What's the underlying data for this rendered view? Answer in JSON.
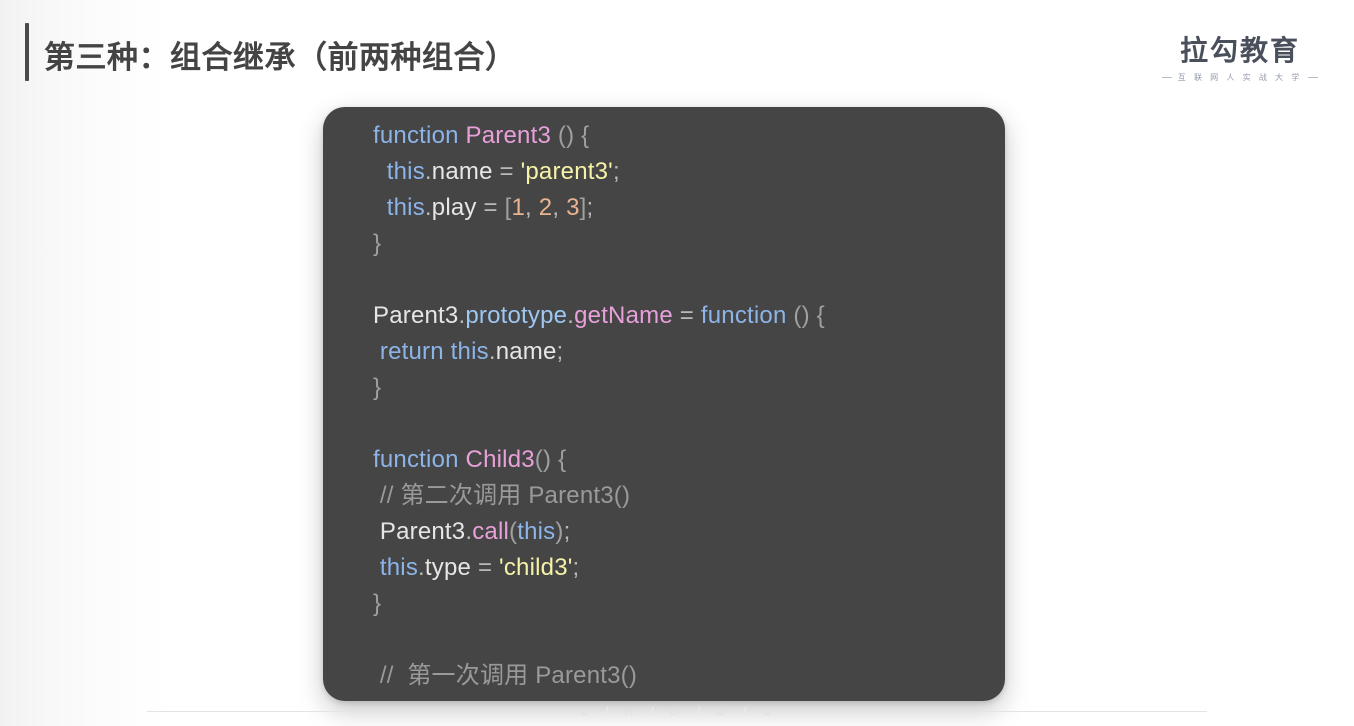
{
  "header": {
    "title": "第三种：组合继承（前两种组合）",
    "brand_name": "拉勾教育",
    "brand_sub": "互 联 网 人 实 战 大 学"
  },
  "colors": {
    "page_background": "#ffffff",
    "code_background": "#454545",
    "title_text": "#444444",
    "accent_bar": "#4a4a4a",
    "keyword": "#8cb4e8",
    "function_name": "#e8a0da",
    "property": "#9dc6f2",
    "string": "#f6f2a8",
    "number": "#eab48f",
    "comment": "#9a9a9a",
    "plain": "#e6e6e6"
  },
  "code": {
    "language": "javascript",
    "lines": [
      "function Parent3 () {",
      "  this.name = 'parent3';",
      "  this.play = [1, 2, 3];",
      "}",
      "",
      "Parent3.prototype.getName = function () {",
      "  return this.name;",
      "}",
      "",
      "function Child3() {",
      "  // 第二次调用 Parent3()",
      "  Parent3.call(this);",
      "  this.type = 'child3';",
      "}",
      "",
      "  // 第一次调用 Parent3()"
    ],
    "tokens": [
      [
        {
          "t": "function",
          "c": "t-kw"
        },
        {
          "t": " ",
          "c": "t-pun"
        },
        {
          "t": "Parent3",
          "c": "t-fn"
        },
        {
          "t": " ",
          "c": "t-pun"
        },
        {
          "t": "()",
          "c": "t-dim"
        },
        {
          "t": " ",
          "c": "t-pun"
        },
        {
          "t": "{",
          "c": "t-dim"
        }
      ],
      [
        {
          "t": "  ",
          "c": "t-pun"
        },
        {
          "t": "this",
          "c": "t-kw"
        },
        {
          "t": ".",
          "c": "t-pun"
        },
        {
          "t": "name",
          "c": "t-id"
        },
        {
          "t": " ",
          "c": "t-pun"
        },
        {
          "t": "=",
          "c": "t-pun"
        },
        {
          "t": " ",
          "c": "t-pun"
        },
        {
          "t": "'parent3'",
          "c": "t-str"
        },
        {
          "t": ";",
          "c": "t-pun"
        }
      ],
      [
        {
          "t": "  ",
          "c": "t-pun"
        },
        {
          "t": "this",
          "c": "t-kw"
        },
        {
          "t": ".",
          "c": "t-pun"
        },
        {
          "t": "play",
          "c": "t-id"
        },
        {
          "t": " ",
          "c": "t-pun"
        },
        {
          "t": "=",
          "c": "t-pun"
        },
        {
          "t": " ",
          "c": "t-pun"
        },
        {
          "t": "[",
          "c": "t-dim"
        },
        {
          "t": "1",
          "c": "t-num"
        },
        {
          "t": ", ",
          "c": "t-pun"
        },
        {
          "t": "2",
          "c": "t-num"
        },
        {
          "t": ", ",
          "c": "t-pun"
        },
        {
          "t": "3",
          "c": "t-num"
        },
        {
          "t": "]",
          "c": "t-dim"
        },
        {
          "t": ";",
          "c": "t-pun"
        }
      ],
      [
        {
          "t": "}",
          "c": "t-dim"
        }
      ],
      [],
      [
        {
          "t": "Parent3",
          "c": "t-id"
        },
        {
          "t": ".",
          "c": "t-pun"
        },
        {
          "t": "prototype",
          "c": "t-prop"
        },
        {
          "t": ".",
          "c": "t-pun"
        },
        {
          "t": "getName",
          "c": "t-fn"
        },
        {
          "t": " ",
          "c": "t-pun"
        },
        {
          "t": "=",
          "c": "t-pun"
        },
        {
          "t": " ",
          "c": "t-pun"
        },
        {
          "t": "function",
          "c": "t-kw"
        },
        {
          "t": " ",
          "c": "t-pun"
        },
        {
          "t": "()",
          "c": "t-dim"
        },
        {
          "t": " ",
          "c": "t-pun"
        },
        {
          "t": "{",
          "c": "t-dim"
        }
      ],
      [
        {
          "t": " ",
          "c": "t-pun"
        },
        {
          "t": "return",
          "c": "t-kw"
        },
        {
          "t": " ",
          "c": "t-pun"
        },
        {
          "t": "this",
          "c": "t-kw"
        },
        {
          "t": ".",
          "c": "t-pun"
        },
        {
          "t": "name",
          "c": "t-id"
        },
        {
          "t": ";",
          "c": "t-pun"
        }
      ],
      [
        {
          "t": "}",
          "c": "t-dim"
        }
      ],
      [],
      [
        {
          "t": "function",
          "c": "t-kw"
        },
        {
          "t": " ",
          "c": "t-pun"
        },
        {
          "t": "Child3",
          "c": "t-fn"
        },
        {
          "t": "()",
          "c": "t-dim"
        },
        {
          "t": " ",
          "c": "t-pun"
        },
        {
          "t": "{",
          "c": "t-dim"
        }
      ],
      [
        {
          "t": " ",
          "c": "t-pun"
        },
        {
          "t": "// 第二次调用 Parent3()",
          "c": "t-cmt"
        }
      ],
      [
        {
          "t": " ",
          "c": "t-pun"
        },
        {
          "t": "Parent3",
          "c": "t-id"
        },
        {
          "t": ".",
          "c": "t-pun"
        },
        {
          "t": "call",
          "c": "t-fn"
        },
        {
          "t": "(",
          "c": "t-dim"
        },
        {
          "t": "this",
          "c": "t-kw"
        },
        {
          "t": ")",
          "c": "t-dim"
        },
        {
          "t": ";",
          "c": "t-pun"
        }
      ],
      [
        {
          "t": " ",
          "c": "t-pun"
        },
        {
          "t": "this",
          "c": "t-kw"
        },
        {
          "t": ".",
          "c": "t-pun"
        },
        {
          "t": "type",
          "c": "t-id"
        },
        {
          "t": " ",
          "c": "t-pun"
        },
        {
          "t": "=",
          "c": "t-pun"
        },
        {
          "t": " ",
          "c": "t-pun"
        },
        {
          "t": "'child3'",
          "c": "t-str"
        },
        {
          "t": ";",
          "c": "t-pun"
        }
      ],
      [
        {
          "t": "}",
          "c": "t-dim"
        }
      ],
      [],
      [
        {
          "t": " ",
          "c": "t-pun"
        },
        {
          "t": "//  第一次调用 Parent3()",
          "c": "t-cmt"
        }
      ]
    ]
  },
  "footer": {
    "letters": [
      "L",
      "A",
      "G",
      "O",
      "U"
    ],
    "separator": "/"
  }
}
